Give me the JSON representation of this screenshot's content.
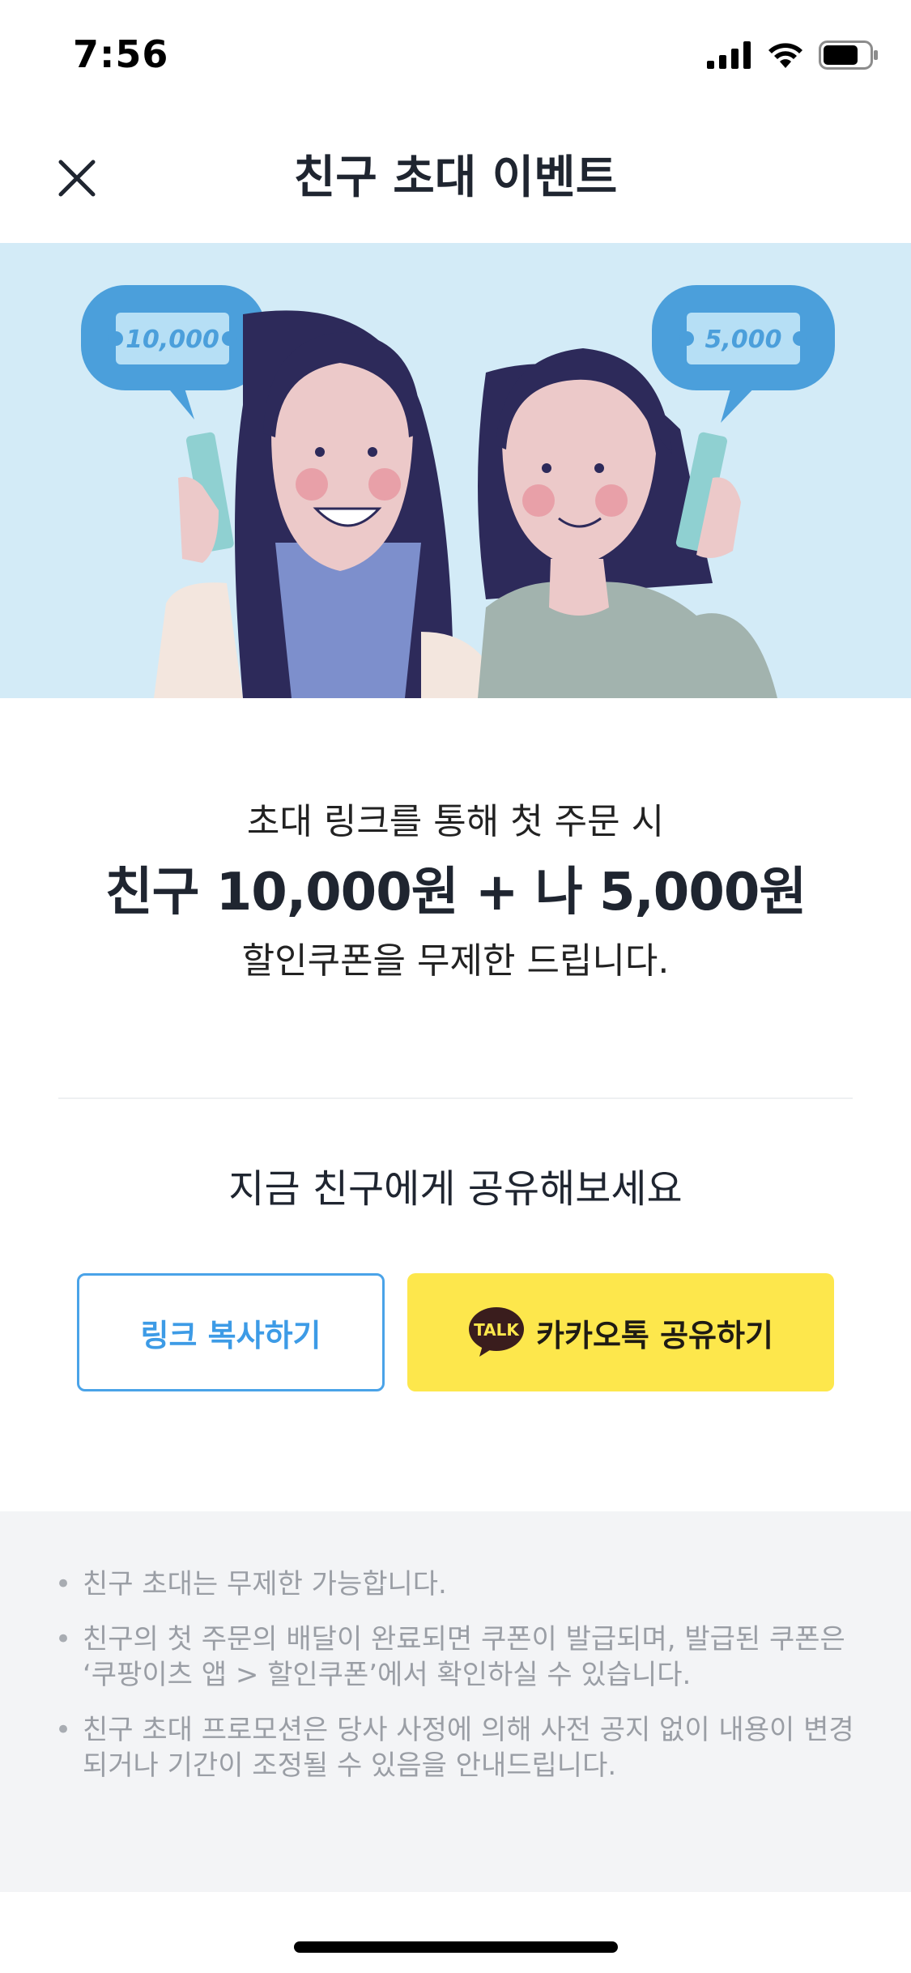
{
  "status_bar": {
    "time": "7:56"
  },
  "nav": {
    "title": "친구 초대 이벤트"
  },
  "hero": {
    "left_ticket": "10,000",
    "right_ticket": "5,000"
  },
  "promo": {
    "line1": "초대 링크를 통해 첫 주문 시",
    "line2": "친구 10,000원 + 나 5,000원",
    "line3": "할인쿠폰을 무제한 드립니다."
  },
  "share": {
    "heading": "지금 친구에게 공유해보세요",
    "copy_link_label": "링크 복사하기",
    "kakao_badge": "TALK",
    "kakao_label": "카카오톡 공유하기"
  },
  "notices": [
    {
      "bullet": "•",
      "text": "친구 초대는 무제한 가능합니다."
    },
    {
      "bullet": "•",
      "text": "친구의 첫 주문의 배달이 완료되면 쿠폰이 발급되며, 발급된 쿠폰은 ‘쿠팡이츠 앱 > 할인쿠폰’에서 확인하실 수 있습니다."
    },
    {
      "bullet": "•",
      "text": "친구 초대 프로모션은 당사 사정에 의해 사전 공지 없이 내용이 변경되거나 기간이 조정될 수 있음을 안내드립니다."
    }
  ],
  "colors": {
    "hero_bg": "#d3ebf7",
    "link_blue": "#3d9be6",
    "kakao_yellow": "#fde74c",
    "notice_bg": "#f3f4f6"
  }
}
